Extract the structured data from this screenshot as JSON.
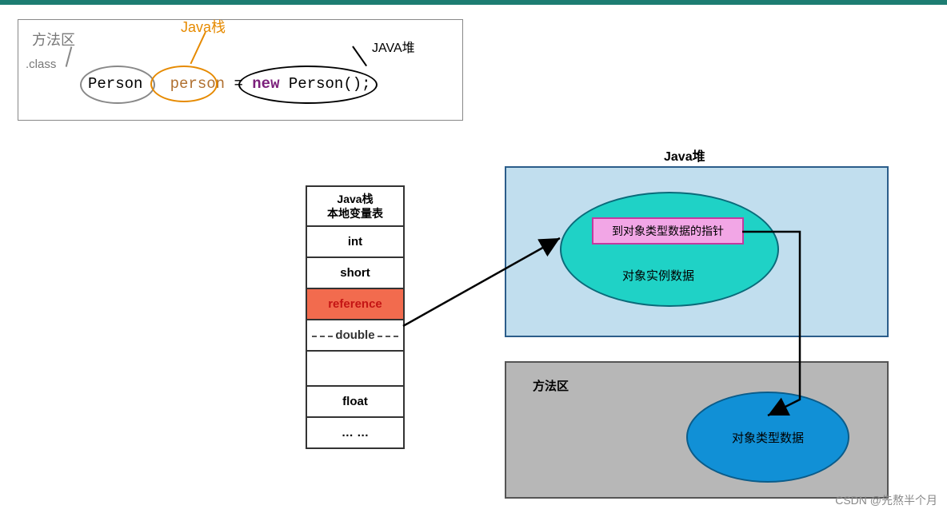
{
  "topbox": {
    "method_area": "方法区",
    "java_stack": "Java栈",
    "class": ".class",
    "java_heap": "JAVA堆",
    "code_class": "Person",
    "code_var": "person",
    "code_eq": " = ",
    "code_new": "new",
    "code_ctor": " Person();"
  },
  "stack": {
    "header_l1": "Java栈",
    "header_l2": "本地变量表",
    "rows": {
      "r0": "int",
      "r1": "short",
      "r2": "reference",
      "r3": "double",
      "r4": "",
      "r5": "float",
      "r6": "… …"
    }
  },
  "heap": {
    "title": "Java堆",
    "inst_ptr": "到对象类型数据的指针",
    "inst_lbl": "对象实例数据"
  },
  "marea": {
    "title": "方法区",
    "typedata": "对象类型数据"
  },
  "watermark": "CSDN @先熬半个月"
}
